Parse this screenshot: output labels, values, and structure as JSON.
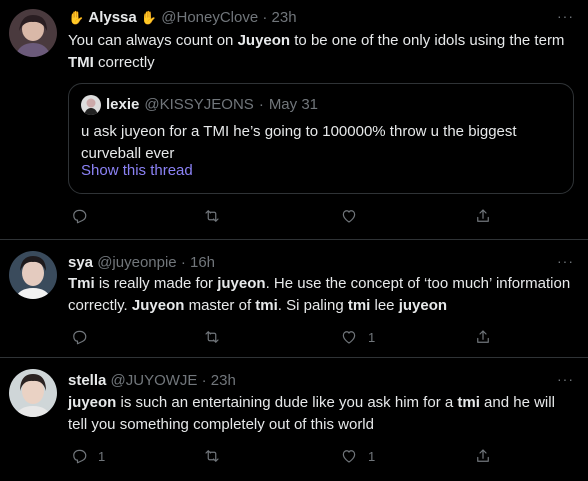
{
  "tweets": [
    {
      "name": "Alyssa",
      "name_emoji": "✋",
      "handle": "@HoneyClove",
      "time": "23h",
      "body_parts": [
        "You can always count on ",
        "Juyeon",
        " to be one of the only idols using the term ",
        "TMI",
        " correctly"
      ],
      "quote": {
        "name": "lexie",
        "handle": "@KISSYJEONS",
        "time": "May 31",
        "body": "u ask juyeon for a TMI he’s going to 100000% throw u the biggest curveball ever",
        "show_thread": "Show this thread"
      },
      "counts": {
        "reply": "",
        "retweet": "",
        "like": ""
      }
    },
    {
      "name": "sya",
      "handle": "@juyeonpie",
      "time": "16h",
      "body_parts": [
        "Tmi",
        " is really made for ",
        "juyeon",
        ". He use the concept of ‘too much’ information correctly. ",
        "Juyeon",
        " master of ",
        "tmi",
        ". Si paling ",
        "tmi",
        " lee ",
        "juyeon"
      ],
      "counts": {
        "reply": "",
        "retweet": "",
        "like": "1"
      }
    },
    {
      "name": "stella",
      "handle": "@JUYOWJE",
      "time": "23h",
      "body_parts": [
        "juyeon",
        " is such an entertaining dude like you ask him for a ",
        "tmi",
        " and he will tell you something completely out of this world"
      ],
      "counts": {
        "reply": "1",
        "retweet": "",
        "like": "1"
      }
    }
  ],
  "separator": "·",
  "more_label": "···",
  "icons": {
    "reply": "reply-icon",
    "retweet": "retweet-icon",
    "like": "heart-icon",
    "share": "share-icon",
    "more": "more-icon"
  },
  "colors": {
    "background": "#000000",
    "text": "#e7e9ea",
    "secondary": "#71767b",
    "link": "#8b82f5",
    "border": "#2f3336"
  }
}
